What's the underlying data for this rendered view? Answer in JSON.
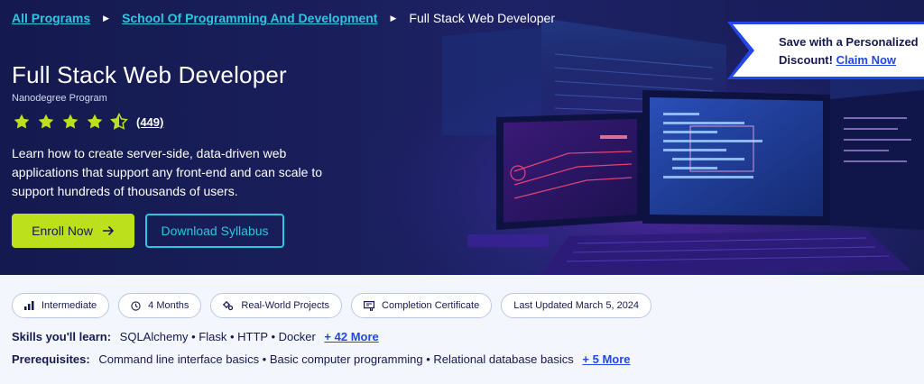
{
  "breadcrumb": {
    "items": [
      "All Programs",
      "School Of Programming And Development"
    ],
    "current": "Full Stack Web Developer",
    "separator": "▶"
  },
  "hero": {
    "title": "Full Stack Web Developer",
    "subtitle": "Nanodegree Program",
    "rating": {
      "stars": 4.5,
      "max": 5,
      "count_label": "(449)"
    },
    "description": "Learn how to create server-side, data-driven web applications that support any front-end and can scale to support hundreds of thousands of users.",
    "enroll_label": "Enroll Now",
    "syllabus_label": "Download Syllabus"
  },
  "promo": {
    "text": "Save with a Personalized Discount!",
    "link": "Claim Now"
  },
  "tags": [
    {
      "icon": "bar-chart-icon",
      "label": "Intermediate"
    },
    {
      "icon": "clock-icon",
      "label": "4 Months"
    },
    {
      "icon": "gears-icon",
      "label": "Real-World Projects"
    },
    {
      "icon": "certificate-icon",
      "label": "Completion Certificate"
    },
    {
      "icon": "",
      "label": "Last Updated March 5, 2024"
    }
  ],
  "skills": {
    "label": "Skills you'll learn:",
    "items": "SQLAlchemy • Flask • HTTP • Docker",
    "more": "+ 42 More"
  },
  "prerequisites": {
    "label": "Prerequisites:",
    "items": "Command line interface basics • Basic computer programming • Relational database basics",
    "more": "+ 5 More"
  },
  "colors": {
    "hero_bg": "#1a1f5c",
    "accent_cyan": "#2ec5e0",
    "accent_lime": "#bde01c",
    "link_blue": "#2346e8",
    "text_dark": "#141a4f"
  }
}
